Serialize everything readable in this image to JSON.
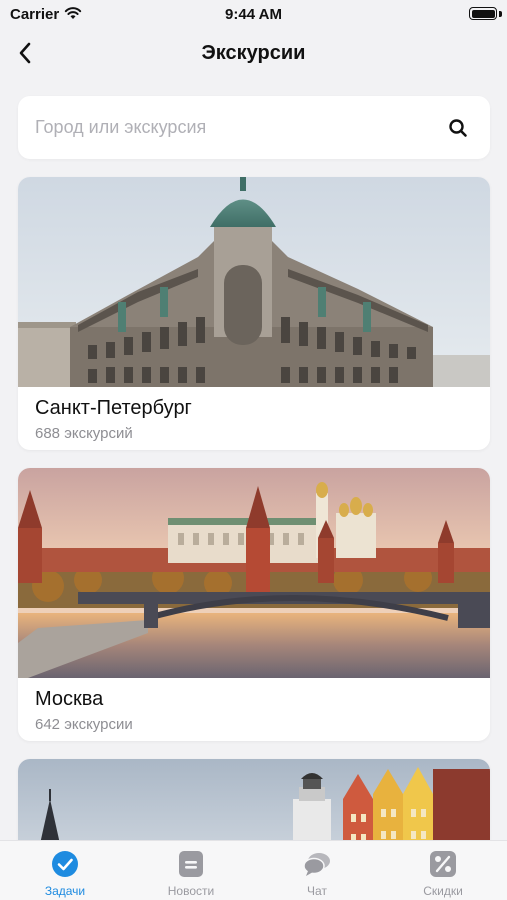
{
  "status_bar": {
    "carrier": "Carrier",
    "time": "9:44 AM"
  },
  "nav": {
    "title": "Экскурсии",
    "back_icon": "chevron-left-icon"
  },
  "search": {
    "placeholder": "Город или экскурсия",
    "value": "",
    "icon": "search-icon"
  },
  "cities": [
    {
      "name": "Санкт-Петербург",
      "count": "688 экскурсий"
    },
    {
      "name": "Москва",
      "count": "642 экскурсии"
    },
    {
      "name": "",
      "count": ""
    }
  ],
  "tabs": [
    {
      "label": "Задачи",
      "icon": "check-circle-icon",
      "active": true
    },
    {
      "label": "Новости",
      "icon": "news-icon",
      "active": false
    },
    {
      "label": "Чат",
      "icon": "chat-icon",
      "active": false
    },
    {
      "label": "Скидки",
      "icon": "discount-icon",
      "active": false
    }
  ],
  "colors": {
    "accent": "#1e8be0",
    "inactive": "#9a9aa0",
    "background": "#f2f2f4"
  }
}
